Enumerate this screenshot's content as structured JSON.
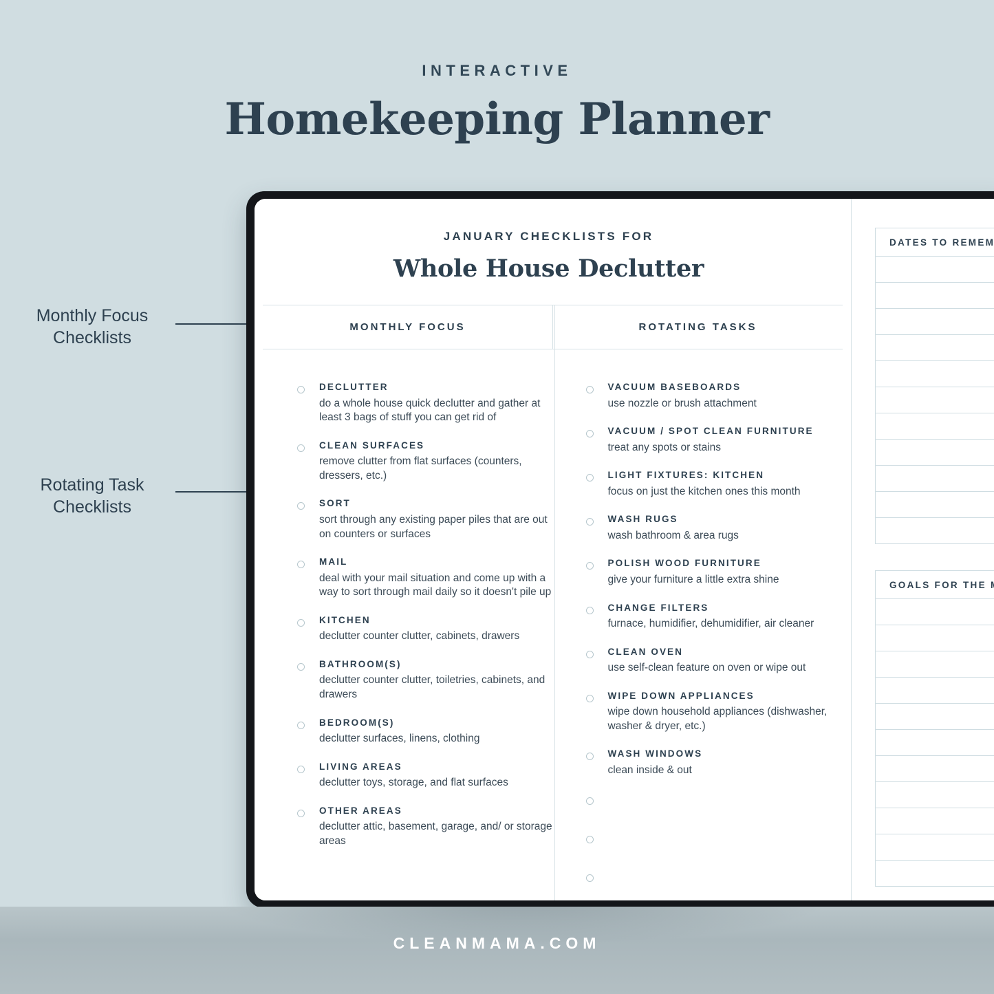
{
  "header": {
    "eyebrow": "INTERACTIVE",
    "title": "Homekeeping Planner"
  },
  "annotations": [
    {
      "line1": "Monthly Focus",
      "line2": "Checklists"
    },
    {
      "line1": "Rotating Task",
      "line2": "Checklists"
    }
  ],
  "checklist": {
    "kicker": "JANUARY CHECKLISTS FOR",
    "title": "Whole House Declutter",
    "columns": [
      {
        "heading": "MONTHLY FOCUS",
        "tasks": [
          {
            "title": "DECLUTTER",
            "desc": "do a whole house quick declutter and gather at least 3 bags of stuff you can get rid of"
          },
          {
            "title": "CLEAN SURFACES",
            "desc": "remove clutter from flat surfaces (counters, dressers, etc.)"
          },
          {
            "title": "SORT",
            "desc": "sort through any existing paper piles that are out on counters or surfaces"
          },
          {
            "title": "MAIL",
            "desc": "deal with your mail situation and come up with a way to sort through mail daily so it doesn't pile up"
          },
          {
            "title": "KITCHEN",
            "desc": "declutter counter clutter, cabinets, drawers"
          },
          {
            "title": "BATHROOM(S)",
            "desc": "declutter counter clutter, toiletries, cabinets, and drawers"
          },
          {
            "title": "BEDROOM(S)",
            "desc": "declutter surfaces, linens, clothing"
          },
          {
            "title": "LIVING AREAS",
            "desc": "declutter toys, storage, and flat surfaces"
          },
          {
            "title": "OTHER AREAS",
            "desc": "declutter attic, basement, garage, and/ or storage areas"
          }
        ]
      },
      {
        "heading": "ROTATING TASKS",
        "tasks": [
          {
            "title": "VACUUM BASEBOARDS",
            "desc": "use nozzle or brush attachment"
          },
          {
            "title": "VACUUM / SPOT CLEAN FURNITURE",
            "desc": "treat any spots or stains"
          },
          {
            "title": "LIGHT FIXTURES: KITCHEN",
            "desc": "focus on just the kitchen ones this month"
          },
          {
            "title": "WASH RUGS",
            "desc": "wash bathroom & area rugs"
          },
          {
            "title": "POLISH WOOD FURNITURE",
            "desc": "give your furniture a little extra shine"
          },
          {
            "title": "CHANGE FILTERS",
            "desc": "furnace, humidifier, dehumidifier, air cleaner"
          },
          {
            "title": "CLEAN OVEN",
            "desc": "use self-clean feature on oven or wipe out"
          },
          {
            "title": "WIPE DOWN APPLIANCES",
            "desc": "wipe down household appliances (dishwasher, washer & dryer, etc.)"
          },
          {
            "title": "WASH WINDOWS",
            "desc": "clean inside & out"
          },
          {
            "title": "",
            "desc": ""
          },
          {
            "title": "",
            "desc": ""
          },
          {
            "title": "",
            "desc": ""
          }
        ]
      }
    ]
  },
  "side_panels": [
    {
      "title": "DATES TO REMEMBER",
      "rows": 11
    },
    {
      "title": "GOALS FOR THE MONTH",
      "rows": 11
    }
  ],
  "footer": {
    "site": "CLEANMAMA.COM"
  },
  "colors": {
    "background": "#d0dde1",
    "ink": "#2e4150",
    "rule": "#d7e2e6",
    "panel_rule": "#cfdde2",
    "checkbox": "#b6c7cd",
    "bezel": "#14161a"
  }
}
